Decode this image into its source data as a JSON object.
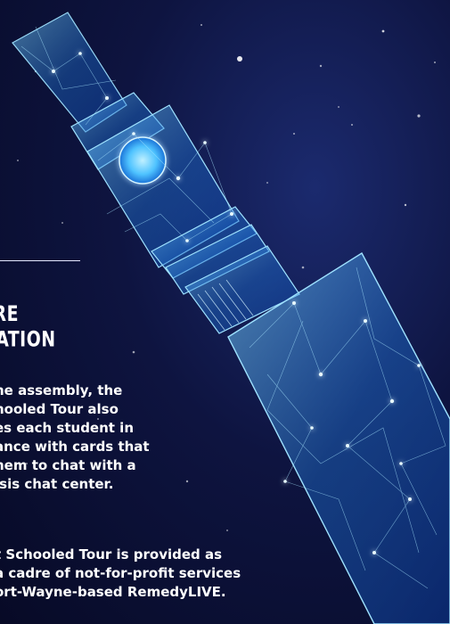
{
  "section": {
    "heading_lines": [
      "ORE",
      "MATION"
    ]
  },
  "paragraphs": [
    {
      "lines": [
        "he assembly, the",
        "hooled Tour also",
        "es each student in",
        "ance with cards that",
        "hem to chat with a",
        "isis chat center."
      ]
    },
    {
      "lines": [
        "t Schooled Tour is provided as",
        "a cadre of not-for-profit services",
        "ort-Wayne-based RemedyLIVE."
      ]
    }
  ],
  "colors": {
    "background": "#0e1440",
    "glow": "#58c8ff",
    "text": "#ffffff"
  },
  "illustration": {
    "icon": "low-poly-vape-pen-icon"
  }
}
